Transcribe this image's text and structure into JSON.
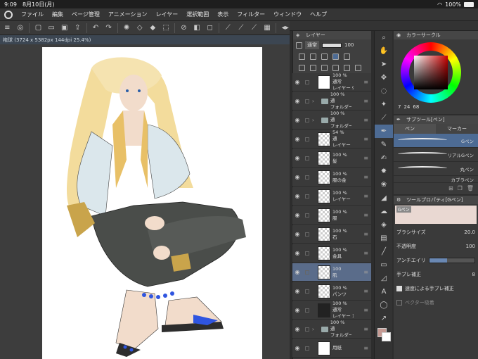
{
  "status": {
    "time": "9:09",
    "date": "8月10日(月)",
    "battery": "100%"
  },
  "menu": [
    "ファイル",
    "編集",
    "ページ管理",
    "アニメーション",
    "レイヤー",
    "選択範囲",
    "表示",
    "フィルター",
    "ウィンドウ",
    "ヘルプ"
  ],
  "doc_tab": "袍球 (3724 x 5382px 144dpi 25.4%)",
  "layer_panel": {
    "title": "レイヤー",
    "blend": "通常",
    "opacity": "100",
    "layers": [
      {
        "pct": "100 %",
        "mode": "通常",
        "name": "レイヤー 9",
        "type": "layer",
        "thumb": "white"
      },
      {
        "pct": "100 %",
        "mode": "通",
        "name": "フォルダー",
        "type": "folder"
      },
      {
        "pct": "100 %",
        "mode": "通",
        "name": "フォルダー",
        "type": "folder"
      },
      {
        "pct": "54 %",
        "mode": "通",
        "name": "レイヤー",
        "type": "layer",
        "thumb": "check"
      },
      {
        "pct": "100 %",
        "mode": "",
        "name": "髪",
        "type": "layer",
        "thumb": "check"
      },
      {
        "pct": "100 %",
        "mode": "",
        "name": "服の金",
        "type": "layer",
        "thumb": "check"
      },
      {
        "pct": "100 %",
        "mode": "",
        "name": "レイヤー",
        "type": "layer",
        "thumb": "check"
      },
      {
        "pct": "100 %",
        "mode": "",
        "name": "服",
        "type": "layer",
        "thumb": "check"
      },
      {
        "pct": "100 %",
        "mode": "",
        "name": "石",
        "type": "layer",
        "thumb": "check"
      },
      {
        "pct": "100 %",
        "mode": "",
        "name": "金具",
        "type": "layer",
        "thumb": "check"
      },
      {
        "pct": "100",
        "mode": "",
        "name": "肌",
        "type": "layer",
        "thumb": "check",
        "selected": true
      },
      {
        "pct": "100 %",
        "mode": "",
        "name": "パンツ",
        "type": "layer",
        "thumb": "check"
      },
      {
        "pct": "100 %",
        "mode": "通常",
        "name": "レイヤー 10",
        "type": "layer",
        "thumb": "dark"
      },
      {
        "pct": "100 %",
        "mode": "通",
        "name": "フォルダー",
        "type": "folder"
      },
      {
        "pct": "",
        "mode": "",
        "name": "用紙",
        "type": "layer",
        "thumb": "white"
      }
    ]
  },
  "color_panel": {
    "title": "カラーサークル",
    "h": "7",
    "s": "24",
    "v": "68"
  },
  "subtool": {
    "title": "サブツール[ペン]",
    "tab1": "ペン",
    "tab2": "マーカー",
    "brushes": [
      "Gペン",
      "リアルGペン",
      "丸ペン",
      "カブラペン"
    ]
  },
  "toolprop": {
    "title": "ツールプロパティ[Gペン]",
    "preset": "Gペン",
    "brush_size_label": "ブラシサイズ",
    "brush_size": "20.0",
    "opacity_label": "不透明度",
    "opacity": "100",
    "aa_label": "アンチエイリ",
    "stab_label": "手ブレ補正",
    "stab": "8",
    "speed_label": "速度による手ブレ補正",
    "vector_label": "ベクター吸着"
  },
  "colors": {
    "accent": "#4d6b94",
    "main": "#c59a93",
    "sub": "#ffffff"
  }
}
